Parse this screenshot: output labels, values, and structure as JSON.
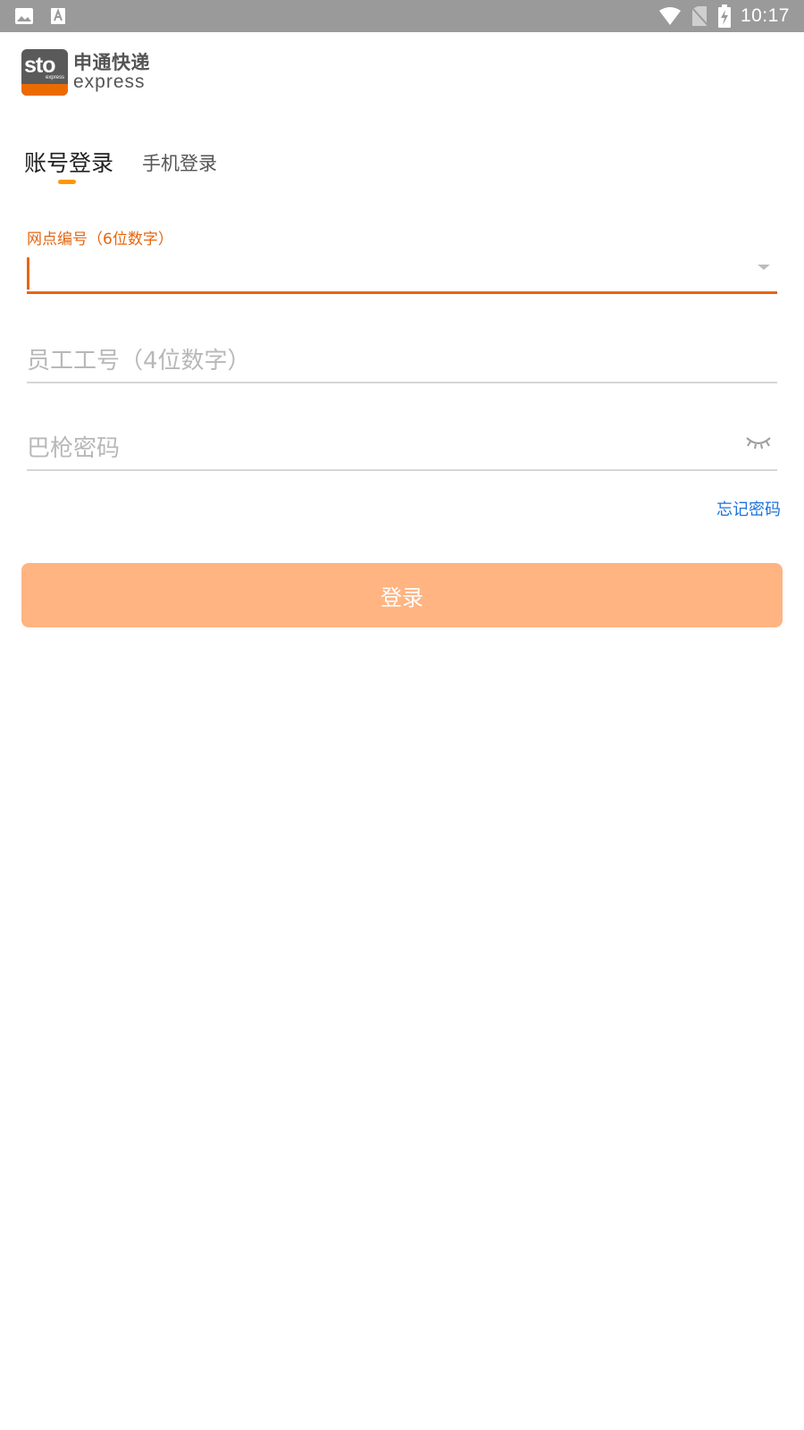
{
  "status_bar": {
    "time": "10:17",
    "left_icons": [
      "image-icon",
      "text-a-icon"
    ],
    "right_icons": [
      "wifi-icon",
      "no-sim-icon",
      "battery-charging-icon"
    ]
  },
  "logo": {
    "mark_text": "sto",
    "mark_subtext": "express",
    "name_cn": "申通快递",
    "name_en": "express",
    "brand_color": "#ec6b00"
  },
  "tabs": [
    {
      "label": "账号登录",
      "active": true
    },
    {
      "label": "手机登录",
      "active": false
    }
  ],
  "form": {
    "network_id": {
      "label": "网点编号（6位数字）",
      "value": "",
      "icon": "dropdown-arrow-icon"
    },
    "employee_id": {
      "placeholder": "员工工号（4位数字）",
      "value": ""
    },
    "password": {
      "placeholder": "巴枪密码",
      "value": "",
      "icon": "eye-closed-icon"
    },
    "forgot_password": "忘记密码",
    "submit_label": "登录"
  },
  "colors": {
    "accent": "#e5660f",
    "tab_indicator": "#ff9800",
    "link": "#1a73d9",
    "button_bg": "#ffb482",
    "status_bar_bg": "#9a9a9a"
  }
}
